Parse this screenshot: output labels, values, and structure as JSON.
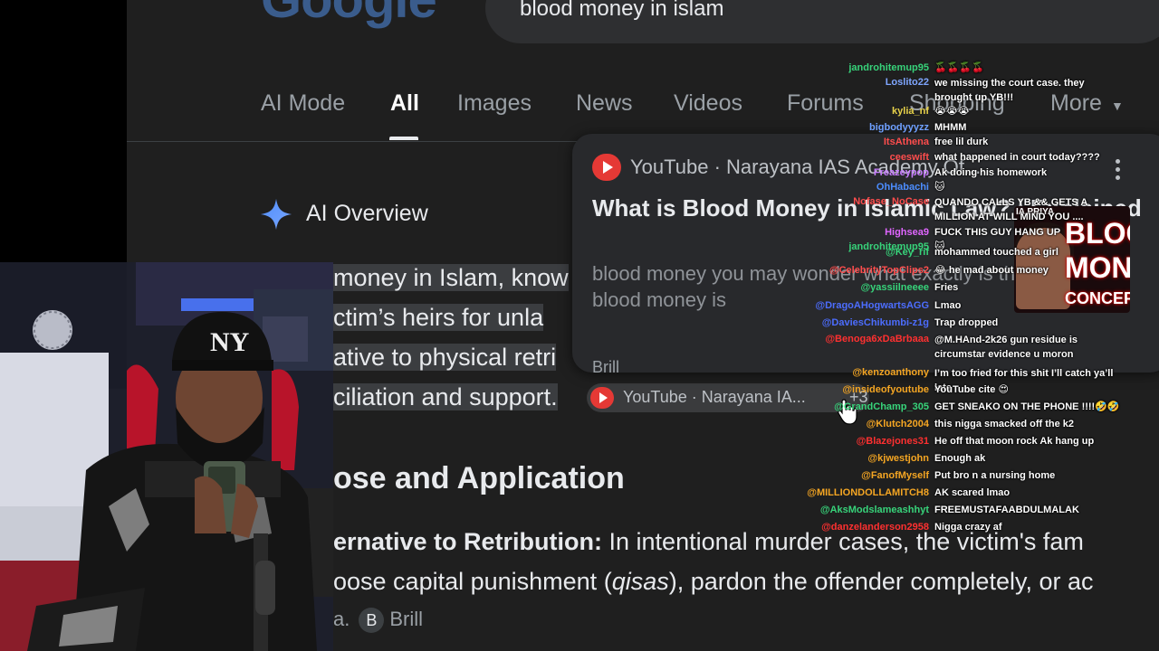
{
  "google": {
    "logo_text": "Google",
    "search_query": "blood money in islam",
    "tabs": [
      {
        "label": "AI Mode"
      },
      {
        "label": "All"
      },
      {
        "label": "Images"
      },
      {
        "label": "News"
      },
      {
        "label": "Videos"
      },
      {
        "label": "Forums"
      },
      {
        "label": "Shopping"
      },
      {
        "label": "More"
      }
    ],
    "ai_overview": {
      "title": "AI Overview",
      "lines": [
        "money in Islam, know",
        "ctim’s heirs for unla",
        "ative to physical retri",
        "ciliation and support."
      ],
      "source_chip": {
        "text": "YouTube · Narayana IA...",
        "extra": "+3"
      },
      "section_heading": "ose and Application",
      "paragraph_bold": "ernative to Retribution:",
      "paragraph_rest": " In intentional murder cases, the victim's fam",
      "paragraph_line2_a": "oose capital punishment (",
      "paragraph_line2_italic": "qisas",
      "paragraph_line2_b": "), pardon the offender completely, or ac",
      "source_prefix": "a.",
      "source_initial": "B",
      "source_name": "Brill"
    },
    "hover_card": {
      "source": "YouTube · Narayana IAS Academy Of...",
      "title": "What is Blood Money in Islamic Law? | Explained",
      "snippet": "blood money you may wonder what exactly is this term. now blood money is",
      "next_source": "Brill"
    }
  },
  "thumbnail": {
    "name": "IA PRIYA",
    "line1": "BLOO",
    "line2": "MON",
    "line3": "CONCEPT"
  },
  "chat": [
    {
      "user": "jandrohitemup95",
      "color": "#37d37a",
      "msg": "🍒🍒🍒🍒"
    },
    {
      "user": "Loslito22",
      "color": "#7fa6ff",
      "msg": "we missing the court case. they brought up YB!!!"
    },
    {
      "user": "kylia_nf",
      "color": "#e8d24a",
      "msg": "😭😭😭"
    },
    {
      "user": "bigbodyyyzz",
      "color": "#6fa0ff",
      "msg": "MHMM"
    },
    {
      "user": "ItsAthena",
      "color": "#ff4d4d",
      "msg": "free lil durk"
    },
    {
      "user": "ceeswift",
      "color": "#ff4d4d",
      "msg": "what happened in court today????"
    },
    {
      "user": "Freazeypop",
      "color": "#c77dff",
      "msg": "Ak doing his homework"
    },
    {
      "user": "OhHabachi",
      "color": "#4c8dff",
      "msg": "🐱"
    },
    {
      "user": "Nofase_NoCase",
      "color": "#ff4d4d",
      "msg": "QUANDO CALLS YB && GETS A MILLION AT WILL MIND YOU ...."
    },
    {
      "user": "Highsea9",
      "color": "#e066ff",
      "msg": "FUCK THIS GUY HANG UP"
    },
    {
      "user": "jandrohitemup95",
      "color": "#37d37a",
      "msg": "🐱"
    },
    {
      "user": "@Key_rif",
      "color": "#37d37a",
      "msg": "mohammed touched a girl"
    },
    {
      "user": "@CelebrityTopClips2",
      "color": "#ff4d4d",
      "msg": "😂 he mad about money"
    },
    {
      "user": "@yassiilneeee",
      "color": "#37d37a",
      "msg": "Fries"
    },
    {
      "user": "@DragoAHogwartsAGG",
      "color": "#4c6dff",
      "msg": "Lmao"
    },
    {
      "user": "@DaviesChikumbi-z1g",
      "color": "#4c6dff",
      "msg": "Trap dropped"
    },
    {
      "user": "@Benoga6xDaBrbaaa",
      "color": "#ff3030",
      "msg": "@M.HAnd-2k26 gun residue is circumstar evidence u moron"
    },
    {
      "user": "@kenzoanthony",
      "color": "#f5a623",
      "msg": "I’m too fried for this shit I’ll catch ya’ll late"
    },
    {
      "user": "@insideofyoutube",
      "color": "#f5a623",
      "msg": "YouTube cite 😍"
    },
    {
      "user": "@GrandChamp_305",
      "color": "#37d37a",
      "msg": "GET SNEAKO ON THE PHONE !!!!🤣🤣"
    },
    {
      "user": "@Klutch2004",
      "color": "#f5a623",
      "msg": "this nigga smacked off the k2"
    },
    {
      "user": "@Blazejones31",
      "color": "#ff3030",
      "msg": "He off that moon rock Ak hang up"
    },
    {
      "user": "@kjwestjohn",
      "color": "#f5a623",
      "msg": "Enough ak"
    },
    {
      "user": "@FanofMyself",
      "color": "#f5a623",
      "msg": "Put bro n a nursing home"
    },
    {
      "user": "@MILLIONDOLLAMITCH8",
      "color": "#f5a623",
      "msg": "AK scared lmao"
    },
    {
      "user": "@AksModslameashhyt",
      "color": "#37d37a",
      "msg": "FREEMUSTAFAABDULMALAK"
    },
    {
      "user": "@danzelanderson2958",
      "color": "#ff3030",
      "msg": "Nigga crazy af"
    }
  ]
}
